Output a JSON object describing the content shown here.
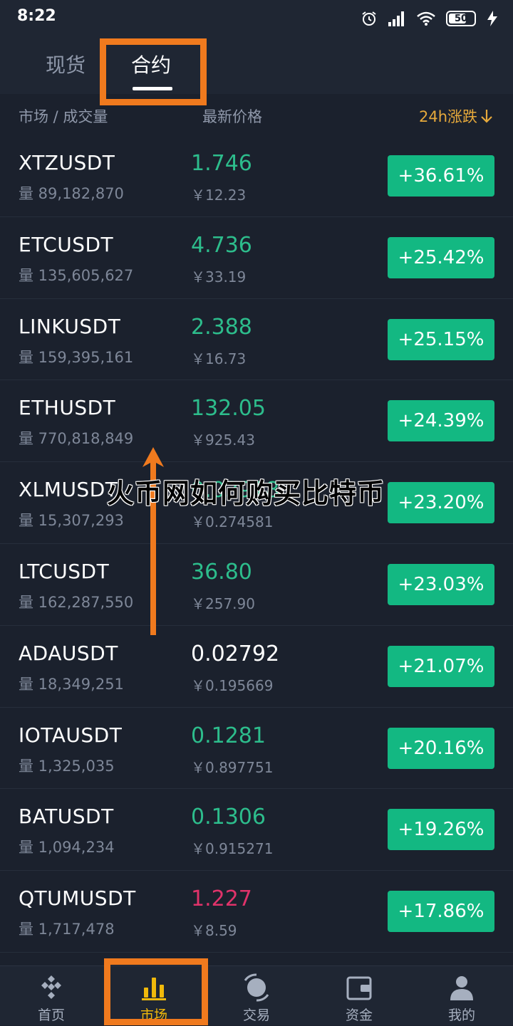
{
  "status_bar": {
    "time": "8:22",
    "battery": "50",
    "icons": [
      "alarm-icon",
      "signal-icon",
      "wifi-icon",
      "battery-icon",
      "charging-icon"
    ]
  },
  "tabs": {
    "spot": "现货",
    "futures": "合约",
    "active": "futures"
  },
  "columns": {
    "market": "市场 / 成交量",
    "price": "最新价格",
    "change": "24h涨跌"
  },
  "rows": [
    {
      "symbol": "XTZUSDT",
      "volume": "量 89,182,870",
      "price": "1.746",
      "price_color": "#2dbd8c",
      "cny": "￥12.23",
      "change": "+36.61%"
    },
    {
      "symbol": "ETCUSDT",
      "volume": "量 135,605,627",
      "price": "4.736",
      "price_color": "#2dbd8c",
      "cny": "￥33.19",
      "change": "+25.42%"
    },
    {
      "symbol": "LINKUSDT",
      "volume": "量 159,395,161",
      "price": "2.388",
      "price_color": "#2dbd8c",
      "cny": "￥16.73",
      "change": "+25.15%"
    },
    {
      "symbol": "ETHUSDT",
      "volume": "量 770,818,849",
      "price": "132.05",
      "price_color": "#2dbd8c",
      "cny": "￥925.43",
      "change": "+24.39%"
    },
    {
      "symbol": "XLMUSDT",
      "volume": "量 15,307,293",
      "price": "0.03918",
      "price_color": "#2dbd8c",
      "cny": "￥0.274581",
      "change": "+23.20%"
    },
    {
      "symbol": "LTCUSDT",
      "volume": "量 162,287,550",
      "price": "36.80",
      "price_color": "#2dbd8c",
      "cny": "￥257.90",
      "change": "+23.03%"
    },
    {
      "symbol": "ADAUSDT",
      "volume": "量 18,349,251",
      "price": "0.02792",
      "price_color": "#ffffff",
      "cny": "￥0.195669",
      "change": "+21.07%"
    },
    {
      "symbol": "IOTAUSDT",
      "volume": "量 1,325,035",
      "price": "0.1281",
      "price_color": "#2dbd8c",
      "cny": "￥0.897751",
      "change": "+20.16%"
    },
    {
      "symbol": "BATUSDT",
      "volume": "量 1,094,234",
      "price": "0.1306",
      "price_color": "#2dbd8c",
      "cny": "￥0.915271",
      "change": "+19.26%"
    },
    {
      "symbol": "QTUMUSDT",
      "volume": "量 1,717,478",
      "price": "1.227",
      "price_color": "#e0336a",
      "cny": "￥8.59",
      "change": "+17.86%"
    }
  ],
  "watermark": "火币网如何购买比特币",
  "colors": {
    "badge_green": "#13b882",
    "highlight_orange": "#f07a1e",
    "accent_yellow": "#f0b90b"
  },
  "bottom_nav": [
    {
      "label": "首页",
      "icon": "home-icon"
    },
    {
      "label": "市场",
      "icon": "market-chart-icon"
    },
    {
      "label": "交易",
      "icon": "trade-icon"
    },
    {
      "label": "资金",
      "icon": "wallet-icon"
    },
    {
      "label": "我的",
      "icon": "profile-icon"
    }
  ],
  "bottom_nav_active": 1
}
